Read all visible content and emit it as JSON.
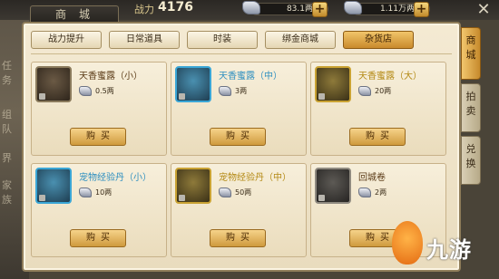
{
  "header": {
    "title": "商城",
    "power_label": "战力",
    "power_value": "4176",
    "currency1": "83.1两",
    "currency2": "1.11万两",
    "plus": "+",
    "close": "✕"
  },
  "backdrop_chars": [
    "任",
    "务",
    "组",
    "队",
    "界",
    "家",
    "族"
  ],
  "tabs": [
    {
      "label": "战力提升",
      "active": false
    },
    {
      "label": "日常道具",
      "active": false
    },
    {
      "label": "时装",
      "active": false
    },
    {
      "label": "绑金商城",
      "active": false
    },
    {
      "label": "杂货店",
      "active": true
    }
  ],
  "items": [
    {
      "name": "天香蜜露（小）",
      "price": "0.5两",
      "icon": "red-potion-small-icon",
      "frame": "default",
      "name_color": "default",
      "buy": "购买"
    },
    {
      "name": "天香蜜露（中）",
      "price": "3两",
      "icon": "red-potion-medium-icon",
      "frame": "blue",
      "name_color": "blue",
      "buy": "购买"
    },
    {
      "name": "天香蜜露（大）",
      "price": "20两",
      "icon": "red-potion-large-icon",
      "frame": "gold",
      "name_color": "gold",
      "buy": "购买"
    },
    {
      "name": "宠物经验丹（小）",
      "price": "10两",
      "icon": "pet-exp-pill-small-icon",
      "frame": "blue",
      "name_color": "blue",
      "buy": "购买"
    },
    {
      "name": "宠物经验丹（中）",
      "price": "50两",
      "icon": "pet-exp-pill-medium-icon",
      "frame": "gold",
      "name_color": "gold",
      "buy": "购买"
    },
    {
      "name": "回城卷",
      "price": "2两",
      "icon": "return-scroll-icon",
      "frame": "grey",
      "name_color": "default",
      "buy": "购买"
    }
  ],
  "side_tabs": [
    {
      "label": "商城",
      "active": true
    },
    {
      "label": "拍卖",
      "active": false
    },
    {
      "label": "兑换",
      "active": false
    }
  ],
  "watermark": "九游"
}
